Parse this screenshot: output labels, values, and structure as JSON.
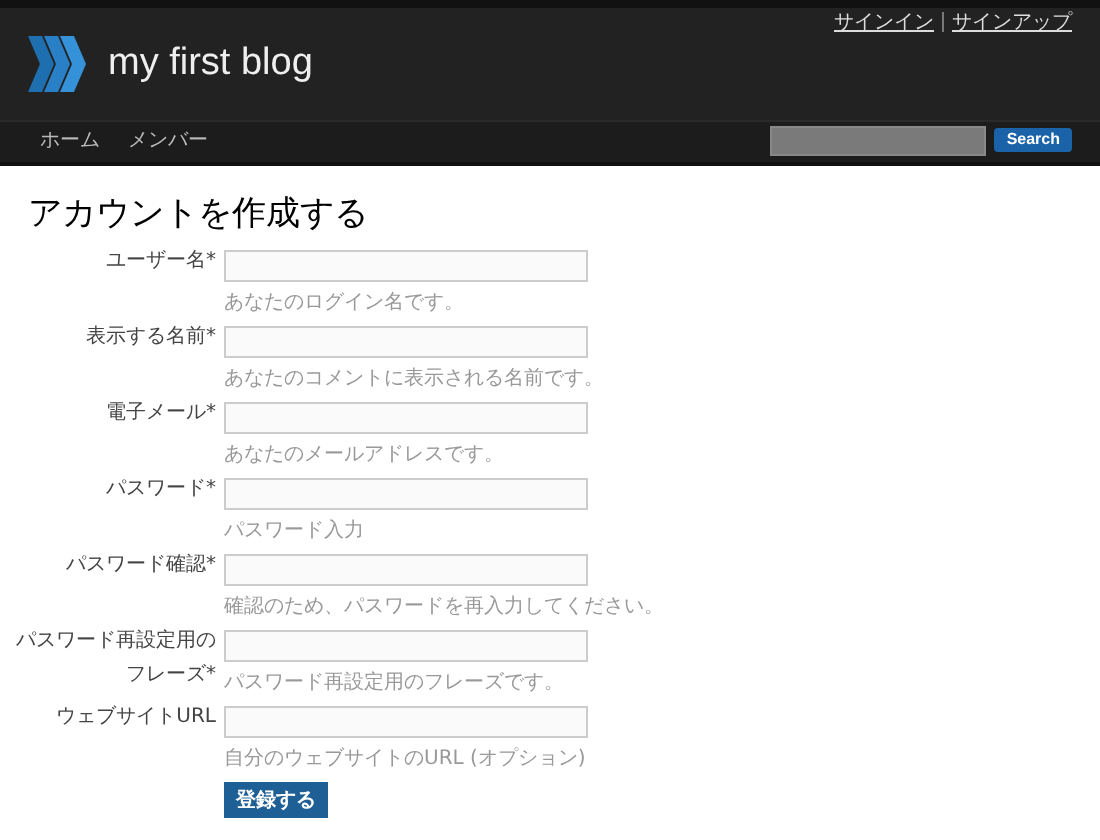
{
  "header": {
    "links": [
      "サインイン",
      "サインアップ"
    ],
    "title": "my first blog"
  },
  "nav": {
    "items": [
      "ホーム",
      "メンバー"
    ],
    "search_button": "Search"
  },
  "page_title": "アカウントを作成する",
  "fields": [
    {
      "label": "ユーザー名*",
      "help": "あなたのログイン名です。"
    },
    {
      "label": "表示する名前*",
      "help": "あなたのコメントに表示される名前です。"
    },
    {
      "label": "電子メール*",
      "help": "あなたのメールアドレスです。"
    },
    {
      "label": "パスワード*",
      "help": "パスワード入力"
    },
    {
      "label": "パスワード確認*",
      "help": "確認のため、パスワードを再入力してください。"
    },
    {
      "label": "パスワード再設定用のフレーズ*",
      "help": "パスワード再設定用のフレーズです。"
    },
    {
      "label": "ウェブサイトURL",
      "help": "自分のウェブサイトのURL (オプション)"
    }
  ],
  "submit": "登録する"
}
